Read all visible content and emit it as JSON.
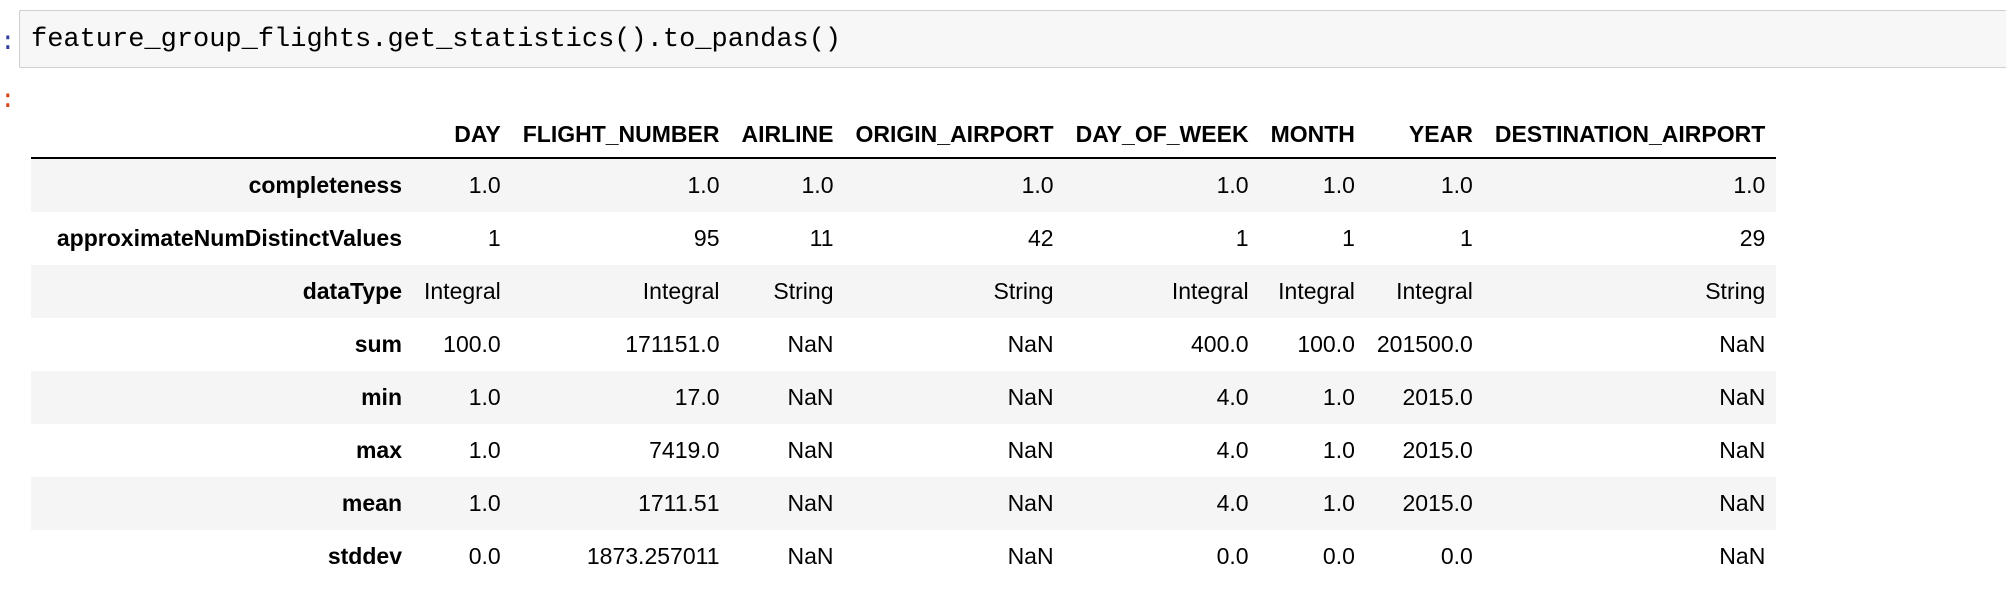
{
  "input_prompt": ":",
  "output_prompt": ":",
  "code": "feature_group_flights.get_statistics().to_pandas()",
  "table": {
    "index_header": "",
    "columns": [
      "DAY",
      "FLIGHT_NUMBER",
      "AIRLINE",
      "ORIGIN_AIRPORT",
      "DAY_OF_WEEK",
      "MONTH",
      "YEAR",
      "DESTINATION_AIRPORT"
    ],
    "rows": [
      {
        "label": "completeness",
        "cells": [
          "1.0",
          "1.0",
          "1.0",
          "1.0",
          "1.0",
          "1.0",
          "1.0",
          "1.0"
        ]
      },
      {
        "label": "approximateNumDistinctValues",
        "cells": [
          "1",
          "95",
          "11",
          "42",
          "1",
          "1",
          "1",
          "29"
        ]
      },
      {
        "label": "dataType",
        "cells": [
          "Integral",
          "Integral",
          "String",
          "String",
          "Integral",
          "Integral",
          "Integral",
          "String"
        ]
      },
      {
        "label": "sum",
        "cells": [
          "100.0",
          "171151.0",
          "NaN",
          "NaN",
          "400.0",
          "100.0",
          "201500.0",
          "NaN"
        ]
      },
      {
        "label": "min",
        "cells": [
          "1.0",
          "17.0",
          "NaN",
          "NaN",
          "4.0",
          "1.0",
          "2015.0",
          "NaN"
        ]
      },
      {
        "label": "max",
        "cells": [
          "1.0",
          "7419.0",
          "NaN",
          "NaN",
          "4.0",
          "1.0",
          "2015.0",
          "NaN"
        ]
      },
      {
        "label": "mean",
        "cells": [
          "1.0",
          "1711.51",
          "NaN",
          "NaN",
          "4.0",
          "1.0",
          "2015.0",
          "NaN"
        ]
      },
      {
        "label": "stddev",
        "cells": [
          "0.0",
          "1873.257011",
          "NaN",
          "NaN",
          "0.0",
          "0.0",
          "0.0",
          "NaN"
        ]
      }
    ]
  }
}
